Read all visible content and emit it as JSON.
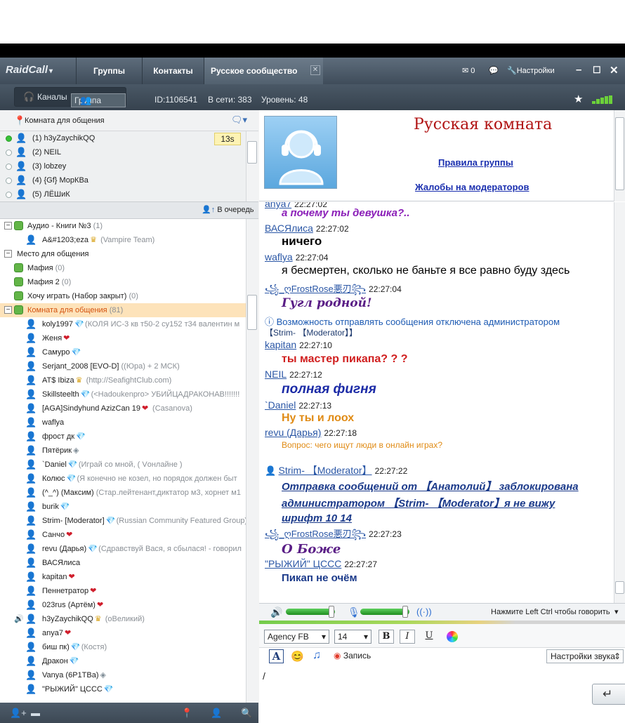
{
  "window": {
    "brand": "RaidCall",
    "tabs": [
      "Группы",
      "Контакты",
      "Русское сообщество"
    ],
    "mail_count": "0",
    "settings_label": "Настройки"
  },
  "subbar": {
    "channels_label": "Каналы",
    "group_label": "Группа",
    "id_text": "ID:1106541",
    "online_text": "В сети: 383",
    "level_text": "Уровень: 48"
  },
  "left": {
    "room_label": "Комната для общения",
    "queue": [
      {
        "label": "(1) h3yZaychikQQ",
        "active": true
      },
      {
        "label": "(2) NEIL",
        "active": false
      },
      {
        "label": "(3) lobzey",
        "active": false
      },
      {
        "label": "(4) {Gf} МорКВа",
        "active": false
      },
      {
        "label": "(5) ЛЁШиК",
        "active": false
      }
    ],
    "queue_timer": "13s",
    "queue_button": "В очередь",
    "tree": [
      {
        "type": "channel",
        "indent": 0,
        "toggle": "−",
        "name": "Аудио - Книги №3",
        "count": "(1)"
      },
      {
        "type": "user",
        "indent": 1,
        "name": "A&#1203;eza",
        "extra": "(Vampire Team)",
        "badge": "crown"
      },
      {
        "type": "group",
        "indent": 0,
        "toggle": "−",
        "name": "Место для общения"
      },
      {
        "type": "channel",
        "indent": 0,
        "name": "Мафия",
        "count": "(0)"
      },
      {
        "type": "channel",
        "indent": 0,
        "name": "Мафия 2",
        "count": "(0)"
      },
      {
        "type": "channel",
        "indent": 0,
        "name": "Хочу играть (Набор закрыт)",
        "count": "(0)"
      },
      {
        "type": "channel",
        "indent": 0,
        "toggle": "−",
        "name": "Комната для общения",
        "count": "(81)",
        "highlight": true
      },
      {
        "type": "user",
        "indent": 1,
        "name": "koly1997",
        "extra": "(КОЛЯ  ИС-3 кв т50-2 су152 т34 валентин м",
        "badge": "gem"
      },
      {
        "type": "user",
        "indent": 1,
        "name": "Женя",
        "extra": "",
        "badge": "heart"
      },
      {
        "type": "user",
        "indent": 1,
        "name": "Самуро",
        "extra": "",
        "badge": "gem"
      },
      {
        "type": "user",
        "indent": 1,
        "name": "Serjant_2008 [EVO-D]",
        "extra": "((Юра) + 2 МСК)",
        "badge": ""
      },
      {
        "type": "user",
        "indent": 1,
        "name": "AT$ Ibiza",
        "extra": "(http://SeafightClub.com)",
        "badge": "crown"
      },
      {
        "type": "user",
        "indent": 1,
        "name": "Skillsteelth",
        "extra": "(<Hadoukenpro> УБИЙЦАДРАКОНАВ!!!!!!!",
        "badge": "gem"
      },
      {
        "type": "user",
        "indent": 1,
        "name": "[AGA]Sindyhund AzizCan 19",
        "extra": "(Casanova)",
        "badge": "heart"
      },
      {
        "type": "user",
        "indent": 1,
        "name": "waflya",
        "extra": "",
        "badge": ""
      },
      {
        "type": "user",
        "indent": 1,
        "name": "фрост дк",
        "extra": "",
        "badge": "gem"
      },
      {
        "type": "user",
        "indent": 1,
        "name": "Пятёрик",
        "extra": "",
        "badge": "gemgray"
      },
      {
        "type": "user",
        "indent": 1,
        "name": "`Daniel",
        "extra": "(Играй со мной, ( Vонлайне )",
        "badge": "gem"
      },
      {
        "type": "user",
        "indent": 1,
        "name": "Колюс",
        "extra": "(Я конечно не козел, но порядок должен быт",
        "badge": "gem"
      },
      {
        "type": "user",
        "indent": 1,
        "name": "(^_^) (Максим)",
        "extra": "(Стар.лейтенант,диктатор м3, хорнет м1",
        "badge": ""
      },
      {
        "type": "user",
        "indent": 1,
        "name": "burik",
        "extra": "",
        "badge": "gem"
      },
      {
        "type": "user",
        "indent": 1,
        "name": "Strim- [Moderator]",
        "extra": "(Russian Community Featured Group)",
        "badge": "gem",
        "orange": true
      },
      {
        "type": "user",
        "indent": 1,
        "name": "Санчо",
        "extra": "",
        "badge": "heart"
      },
      {
        "type": "user",
        "indent": 1,
        "name": "revu (Дарья)",
        "extra": "(Сдравствуй Вася, я сбылася! - говорил",
        "badge": "gem"
      },
      {
        "type": "user",
        "indent": 1,
        "name": "ВАСЯлиса",
        "extra": "",
        "badge": ""
      },
      {
        "type": "user",
        "indent": 1,
        "name": "kapitan",
        "extra": "",
        "badge": "heart"
      },
      {
        "type": "user",
        "indent": 1,
        "name": "Пеннетратор",
        "extra": "",
        "badge": "heart"
      },
      {
        "type": "user",
        "indent": 1,
        "name": "023rus (Артём)",
        "extra": "",
        "badge": "heart"
      },
      {
        "type": "user",
        "indent": 1,
        "name": "h3yZaychikQQ",
        "extra": "(оВеликий)",
        "badge": "crown",
        "speaking": true
      },
      {
        "type": "user",
        "indent": 1,
        "name": "anya7",
        "extra": "",
        "badge": "heart"
      },
      {
        "type": "user",
        "indent": 1,
        "name": "биш пк)",
        "extra": "(Костя)",
        "badge": "gem"
      },
      {
        "type": "user",
        "indent": 1,
        "name": "Дракон",
        "extra": "",
        "badge": "gem"
      },
      {
        "type": "user",
        "indent": 1,
        "name": "  Vanya       (6P1TBa)",
        "extra": "",
        "badge": "gemgray"
      },
      {
        "type": "user",
        "indent": 1,
        "name": "\"РЫЖИЙ\" ЦССС",
        "extra": "",
        "badge": "gem"
      }
    ]
  },
  "banner": {
    "title": "Русская комната",
    "link_rules": "Правила группы",
    "link_complaints": "Жалобы на модераторов"
  },
  "chat": {
    "top_partial_text": "а почему ты девушка?..",
    "top_partial_nick": "anyа7",
    "messages": [
      {
        "nick": "ВАСЯлиса",
        "time": "22:27:02",
        "text": "ничего"
      },
      {
        "nick": "waflya",
        "time": "22:27:04",
        "text": "я бесмертен, сколько не баньте я все равно буду здесь"
      },
      {
        "nick": "꧁_ღFrostRose悪刃꧂",
        "time": "22:27:04",
        "text": "Гугл родной!"
      },
      {
        "nick": "kapitan",
        "time": "22:27:10",
        "text": "ты мастер пикапа? ? ?"
      },
      {
        "nick": "NEIL",
        "time": "22:27:12",
        "text": "полная фигня"
      },
      {
        "nick": "`Daniel",
        "time": "22:27:13",
        "text": "Ну ты и лоох"
      },
      {
        "nick": "revu (Дарья)",
        "time": "22:27:18",
        "text": "Вопрос: чего ищут люди в онлайн играх?"
      },
      {
        "nick": "Strim- 【Moderator】",
        "time": "22:27:22",
        "text": "Отправка сообщений от 【Анатолий】 заблокирована администратором 【Strim- 【Moderator】я не вижу шрифт 10 14"
      },
      {
        "nick": "꧁_ღFrostRose悪刃꧂",
        "time": "22:27:23",
        "text": "О Боже"
      },
      {
        "nick": "\"РЫЖИЙ\" ЦССС",
        "time": "22:27:27",
        "text": "Пикап не очём"
      }
    ],
    "system_notice": "Возможность отправлять сообщения отключена администратором",
    "system_notice_by": "【Strim- 【Moderator】】",
    "mod_line2": "администратором 【Strim- 【Moderator】я не вижу",
    "mod_line3": "шрифт 10 14",
    "mod_line1": "Отправка сообщений от 【Анатолий】 заблокирована"
  },
  "controls": {
    "ptt_hint": "Нажмите Left Ctrl чтобы говорить",
    "font_name": "Agency FB",
    "font_size": "14",
    "bold": "B",
    "italic": "I",
    "underline": "U",
    "record_label": "Запись",
    "sound_settings": "Настройки звука",
    "mic_level": 1.0,
    "speaker_level": 1.0,
    "input_text": "/"
  }
}
